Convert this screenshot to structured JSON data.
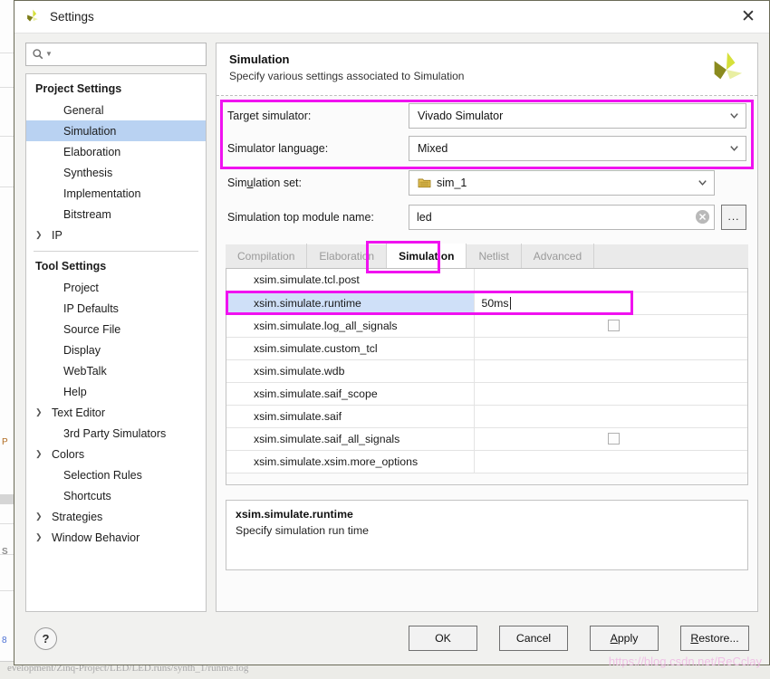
{
  "window": {
    "title": "Settings",
    "logo_icon": "xilinx-logo-icon",
    "close_icon": "close-icon"
  },
  "search": {
    "placeholder": "",
    "value": "",
    "icon": "search-icon",
    "caret_icon": "chevron-down-icon"
  },
  "sidebar": {
    "groups": [
      {
        "label": "Project Settings",
        "items": [
          {
            "label": "General",
            "expandable": false,
            "selected": false
          },
          {
            "label": "Simulation",
            "expandable": false,
            "selected": true
          },
          {
            "label": "Elaboration",
            "expandable": false,
            "selected": false
          },
          {
            "label": "Synthesis",
            "expandable": false,
            "selected": false
          },
          {
            "label": "Implementation",
            "expandable": false,
            "selected": false
          },
          {
            "label": "Bitstream",
            "expandable": false,
            "selected": false
          },
          {
            "label": "IP",
            "expandable": true,
            "selected": false
          }
        ]
      },
      {
        "label": "Tool Settings",
        "items": [
          {
            "label": "Project",
            "expandable": false,
            "selected": false
          },
          {
            "label": "IP Defaults",
            "expandable": false,
            "selected": false
          },
          {
            "label": "Source File",
            "expandable": false,
            "selected": false
          },
          {
            "label": "Display",
            "expandable": false,
            "selected": false
          },
          {
            "label": "WebTalk",
            "expandable": false,
            "selected": false
          },
          {
            "label": "Help",
            "expandable": false,
            "selected": false
          },
          {
            "label": "Text Editor",
            "expandable": true,
            "selected": false
          },
          {
            "label": "3rd Party Simulators",
            "expandable": false,
            "selected": false
          },
          {
            "label": "Colors",
            "expandable": true,
            "selected": false
          },
          {
            "label": "Selection Rules",
            "expandable": false,
            "selected": false
          },
          {
            "label": "Shortcuts",
            "expandable": false,
            "selected": false
          },
          {
            "label": "Strategies",
            "expandable": true,
            "selected": false
          },
          {
            "label": "Window Behavior",
            "expandable": true,
            "selected": false
          }
        ]
      }
    ],
    "expand_arrow_glyph": "❯"
  },
  "panel": {
    "title": "Simulation",
    "subtitle": "Specify various settings associated to Simulation",
    "logo_icon": "xilinx-logo-icon"
  },
  "form": {
    "target_simulator": {
      "label": "Target simulator:",
      "value": "Vivado Simulator",
      "chevron_icon": "chevron-down-icon"
    },
    "simulator_language": {
      "label": "Simulator language:",
      "value": "Mixed",
      "chevron_icon": "chevron-down-icon"
    },
    "simulation_set": {
      "label": "Simulation set:",
      "value": "sim_1",
      "icon": "folder-icon",
      "chevron_icon": "chevron-down-icon"
    },
    "top_module": {
      "label": "Simulation top module name:",
      "value": "led",
      "placeholder": "",
      "clear_icon": "clear-circle-icon",
      "browse_label": "..."
    }
  },
  "tabs": [
    {
      "label": "Compilation",
      "active": false
    },
    {
      "label": "Elaboration",
      "active": false
    },
    {
      "label": "Simulation",
      "active": true
    },
    {
      "label": "Netlist",
      "active": false
    },
    {
      "label": "Advanced",
      "active": false
    }
  ],
  "property_table": {
    "rows": [
      {
        "name": "xsim.simulate.tcl.post",
        "value": "",
        "type": "text",
        "selected": false
      },
      {
        "name": "xsim.simulate.runtime",
        "value": "50ms",
        "type": "editing",
        "selected": true
      },
      {
        "name": "xsim.simulate.log_all_signals",
        "value": "",
        "type": "checkbox",
        "checked": false,
        "selected": false
      },
      {
        "name": "xsim.simulate.custom_tcl",
        "value": "",
        "type": "text",
        "selected": false
      },
      {
        "name": "xsim.simulate.wdb",
        "value": "",
        "type": "text",
        "selected": false
      },
      {
        "name": "xsim.simulate.saif_scope",
        "value": "",
        "type": "text",
        "selected": false
      },
      {
        "name": "xsim.simulate.saif",
        "value": "",
        "type": "text",
        "selected": false
      },
      {
        "name": "xsim.simulate.saif_all_signals",
        "value": "",
        "type": "checkbox",
        "checked": false,
        "selected": false
      },
      {
        "name": "xsim.simulate.xsim.more_options",
        "value": "",
        "type": "text",
        "selected": false
      }
    ]
  },
  "description": {
    "title": "xsim.simulate.runtime",
    "text": "Specify simulation run time"
  },
  "footer": {
    "help_label": "?",
    "buttons": [
      {
        "label": "OK",
        "mnemonic": ""
      },
      {
        "label": "Cancel",
        "mnemonic": ""
      },
      {
        "label": "Apply",
        "mnemonic": "A"
      },
      {
        "label": "Restore...",
        "mnemonic": "R"
      }
    ]
  },
  "background": {
    "status_path": "evelopment/Zinq-Project/LED/LED.runs/synth_1/runme.log",
    "watermark": "https://blog.csdn.net/ReCclay"
  },
  "colors": {
    "annotation": "#f012f0",
    "selection": "#b9d2f2",
    "row_selection": "#cfe0f8",
    "logo_bright": "#d6e03a",
    "logo_dark": "#8a8a1e",
    "logo_pale": "#e9efa3"
  }
}
